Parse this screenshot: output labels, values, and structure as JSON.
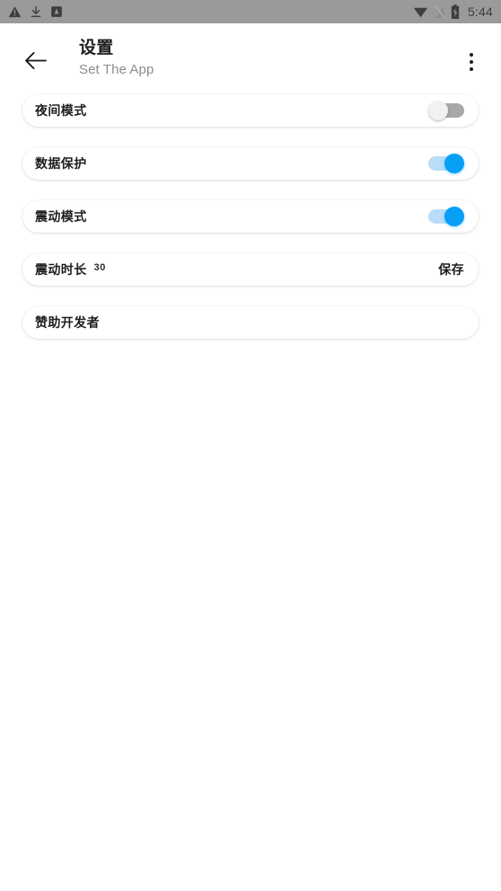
{
  "statusbar": {
    "icons_left": [
      "warning-triangle-icon",
      "download-icon",
      "app-badge-icon"
    ],
    "icons_right": [
      "wifi-icon",
      "signal-off-icon",
      "battery-charging-icon"
    ],
    "clock": "5:44",
    "background": "#9a9a9a"
  },
  "header": {
    "back_icon": "back-arrow-icon",
    "title": "设置",
    "subtitle": "Set The App",
    "overflow_icon": "more-vertical-icon"
  },
  "colors": {
    "accent_on_thumb": "#08a0f7",
    "accent_on_track": "#b9dcf8",
    "off_thumb": "#f1f1f1",
    "off_track": "#a8a8a8",
    "page_background": "#ffffff"
  },
  "settings": [
    {
      "key": "night_mode",
      "label": "夜间模式",
      "type": "switch",
      "state": "off"
    },
    {
      "key": "data_protection",
      "label": "数据保护",
      "type": "switch",
      "state": "on"
    },
    {
      "key": "vibration_mode",
      "label": "震动模式",
      "type": "switch",
      "state": "on"
    },
    {
      "key": "vibration_duration",
      "label": "震动时长",
      "type": "input",
      "value": "30",
      "action_label": "保存"
    },
    {
      "key": "sponsor_developer",
      "label": "赞助开发者",
      "type": "link"
    }
  ]
}
